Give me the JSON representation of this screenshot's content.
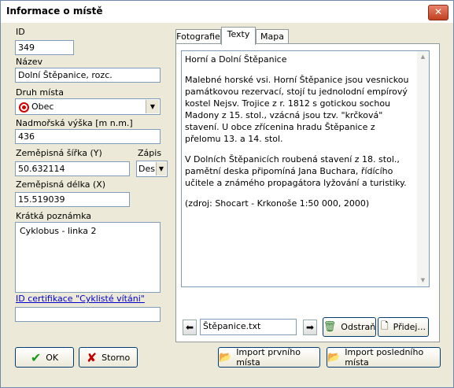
{
  "window": {
    "title": "Informace o místě",
    "close_glyph": "✕"
  },
  "form": {
    "id_label": "ID",
    "id_value": "349",
    "name_label": "Název",
    "name_value": "Dolní Štěpanice, rozc.",
    "type_label": "Druh místa",
    "type_value": "Obec",
    "altitude_label": "Nadmořská výška [m n.m.]",
    "altitude_value": "436",
    "lat_label": "Zeměpisná šířka (Y)",
    "lat_value": "50.632114",
    "format_label": "Zápis",
    "format_value": "Des",
    "lon_label": "Zeměpisná délka (X)",
    "lon_value": "15.519039",
    "note_label": "Krátká poznámka",
    "note_value": "Cyklobus - linka 2",
    "cert_link": "ID certifikace \"Cyklisté vítáni\"",
    "cert_value": ""
  },
  "tabs": [
    {
      "label": "Fotografie",
      "active": false
    },
    {
      "label": "Texty",
      "active": true
    },
    {
      "label": "Mapa",
      "active": false
    }
  ],
  "text_panel": {
    "paragraphs": [
      "Horní a Dolní Štěpanice",
      "Malebné horské vsi. Horní Štěpanice jsou vesnickou památkovou rezervací, stojí tu jednolodní empírový kostel Nejsv. Trojice z r. 1812 s gotickou sochou Madony z 15. stol., vzácná jsou tzv. \"krčková\" stavení. U obce zřícenina hradu Štěpanice z přelomu 13. a 14. stol.",
      "V Dolních Štěpanicích roubená stavení z 18. stol., pamětní deska připomíná Jana Buchara, řídícího učitele a známého propagátora lyžování a turistiky.",
      "(zdroj: Shocart - Krkonoše 1:50 000, 2000)"
    ],
    "file_name": "Štěpanice.txt",
    "delete_label": "Odstraň",
    "add_label": "Přidej..."
  },
  "buttons": {
    "ok": "OK",
    "cancel": "Storno",
    "import_first": "Import prvního místa",
    "import_last": "Import posledního místa"
  },
  "colors": {
    "ok_check": "#1a9a1a",
    "cancel_x": "#c00000",
    "link": "#0000cc"
  }
}
